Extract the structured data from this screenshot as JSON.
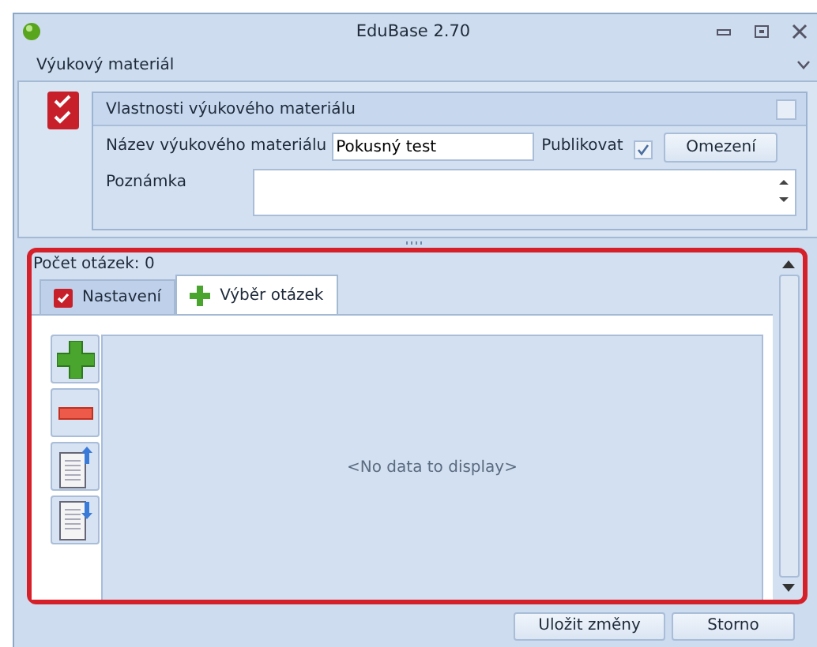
{
  "window": {
    "title": "EduBase 2.70"
  },
  "section": {
    "title": "Výukový materiál"
  },
  "properties": {
    "title": "Vlastnosti výukového materiálu",
    "name_label": "Název výukového materiálu",
    "name_value": "Pokusný test",
    "publish_label": "Publikovat",
    "publish_checked": true,
    "restrict_button": "Omezení",
    "note_label": "Poznámka"
  },
  "question_count": "Počet otázek: 0",
  "tabs": [
    {
      "label": "Nastavení",
      "selected": false,
      "kind": "check"
    },
    {
      "label": "Výběr otázek",
      "selected": true,
      "kind": "plus"
    }
  ],
  "grid": {
    "empty_text": "<No data to display>"
  },
  "buttons": [
    "Uložit změny",
    "Storno"
  ]
}
